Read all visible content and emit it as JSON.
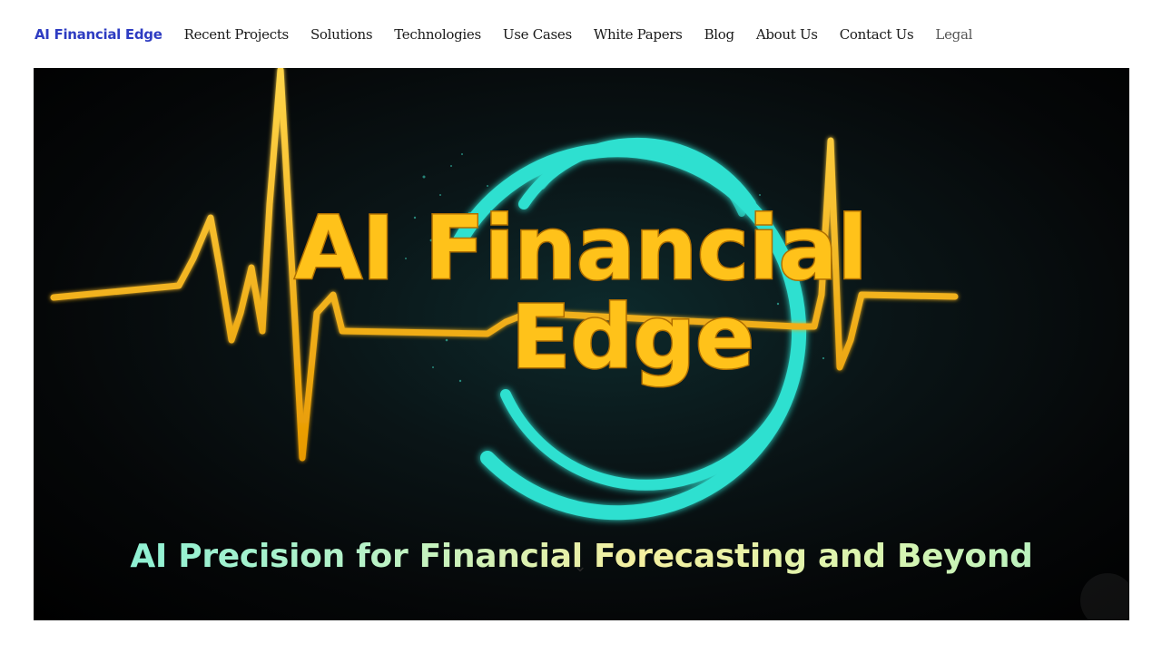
{
  "nav": {
    "brand": "AI Financial Edge",
    "links": [
      "Recent Projects",
      "Solutions",
      "Technologies",
      "Use Cases",
      "White Papers",
      "Blog",
      "About Us",
      "Contact Us",
      "Legal"
    ]
  },
  "hero": {
    "logo_line1": "AI Financial",
    "logo_line2": "Edge",
    "tagline": "AI Precision for Financial Forecasting and Beyond"
  },
  "colors": {
    "brand": "#2e3cc2",
    "logo_gold": "#ffc21a",
    "ring_teal": "#2ee0d0"
  },
  "icons": [
    "scroll-down-chevron-icon"
  ]
}
